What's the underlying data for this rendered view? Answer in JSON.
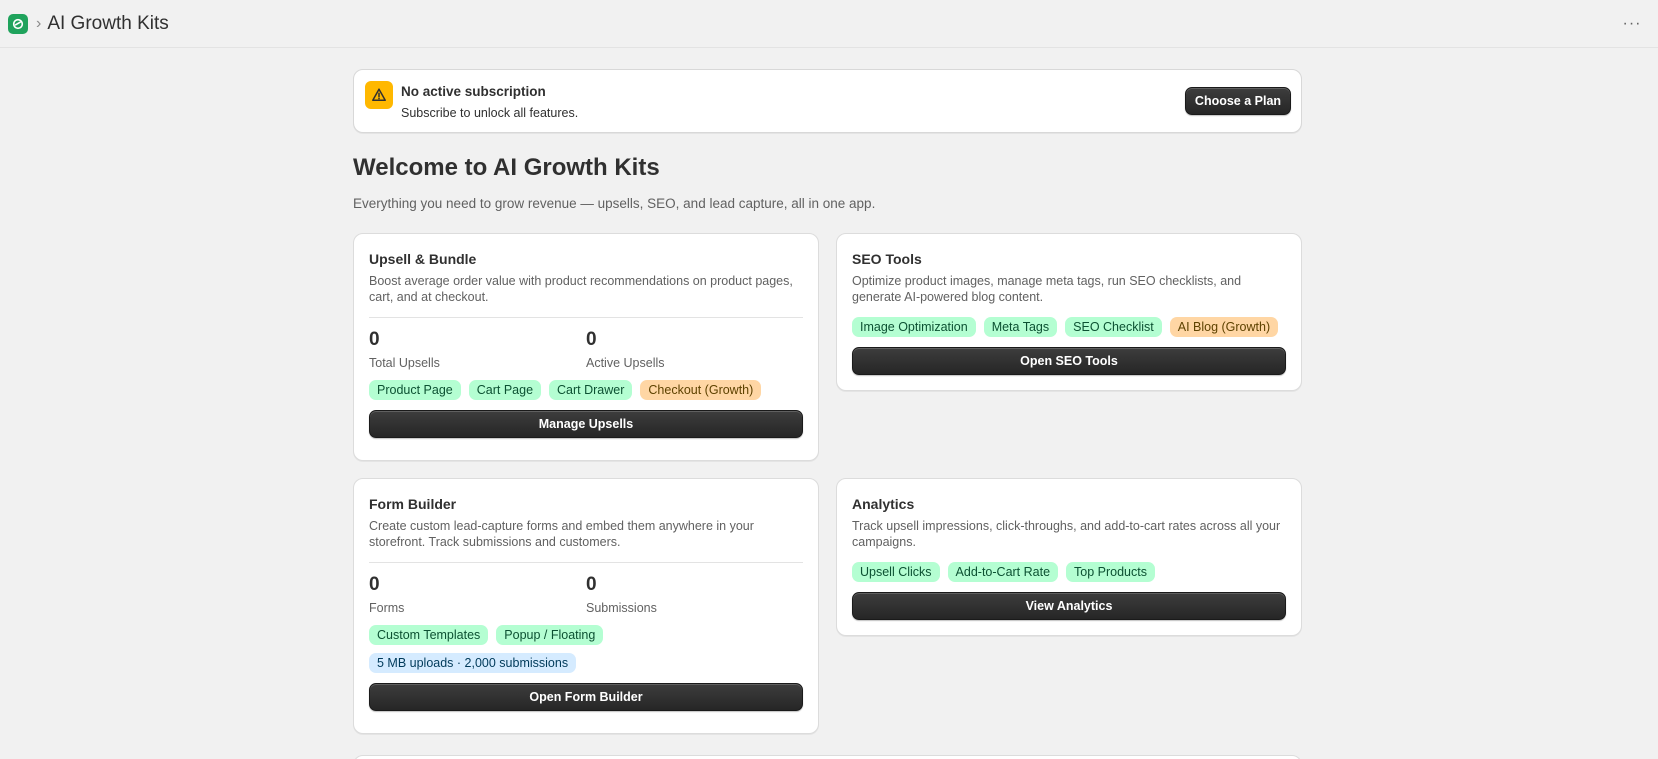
{
  "header": {
    "app_title": "AI Growth Kits",
    "breadcrumb_separator": "›",
    "more_icon_glyph": "···"
  },
  "banner": {
    "title": "No active subscription",
    "text": "Subscribe to unlock all features.",
    "button_label": "Choose a Plan"
  },
  "page": {
    "title": "Welcome to AI Growth Kits",
    "subtitle": "Everything you need to grow revenue — upsells, SEO, and lead capture, all in one app."
  },
  "cards": {
    "upsell": {
      "title": "Upsell & Bundle",
      "description": "Boost average order value with product recommendations on product pages, cart, and at checkout.",
      "stats": [
        {
          "value": "0",
          "label": "Total Upsells"
        },
        {
          "value": "0",
          "label": "Active Upsells"
        }
      ],
      "tags": [
        {
          "label": "Product Page",
          "tone": "green"
        },
        {
          "label": "Cart Page",
          "tone": "green"
        },
        {
          "label": "Cart Drawer",
          "tone": "green"
        },
        {
          "label": "Checkout (Growth)",
          "tone": "orange"
        }
      ],
      "button_label": "Manage Upsells"
    },
    "seo": {
      "title": "SEO Tools",
      "description": "Optimize product images, manage meta tags, run SEO checklists, and generate AI-powered blog content.",
      "tags": [
        {
          "label": "Image Optimization",
          "tone": "green"
        },
        {
          "label": "Meta Tags",
          "tone": "green"
        },
        {
          "label": "SEO Checklist",
          "tone": "green"
        },
        {
          "label": "AI Blog (Growth)",
          "tone": "orange"
        }
      ],
      "button_label": "Open SEO Tools"
    },
    "form": {
      "title": "Form Builder",
      "description": "Create custom lead-capture forms and embed them anywhere in your storefront. Track submissions and customers.",
      "stats": [
        {
          "value": "0",
          "label": "Forms"
        },
        {
          "value": "0",
          "label": "Submissions"
        }
      ],
      "tags": [
        {
          "label": "Custom Templates",
          "tone": "green"
        },
        {
          "label": "Popup / Floating",
          "tone": "green"
        },
        {
          "label": "5 MB uploads · 2,000 submissions",
          "tone": "blue"
        }
      ],
      "button_label": "Open Form Builder"
    },
    "analytics": {
      "title": "Analytics",
      "description": "Track upsell impressions, click-throughs, and add-to-cart rates across all your campaigns.",
      "tags": [
        {
          "label": "Upsell Clicks",
          "tone": "green"
        },
        {
          "label": "Add-to-Cart Rate",
          "tone": "green"
        },
        {
          "label": "Top Products",
          "tone": "green"
        }
      ],
      "button_label": "View Analytics"
    }
  },
  "colors": {
    "background": "#f1f1f1",
    "brand_green": "#1fa35c",
    "warning_yellow": "#ffb800",
    "tag_green": "#b4fed2",
    "tag_orange": "#ffd6a4",
    "tag_blue": "#d5ebff",
    "button_dark": "#303030"
  },
  "icons": {
    "app_logo": "shopify-app-icon",
    "banner": "warning-triangle-icon",
    "more": "more-horizontal-icon"
  }
}
